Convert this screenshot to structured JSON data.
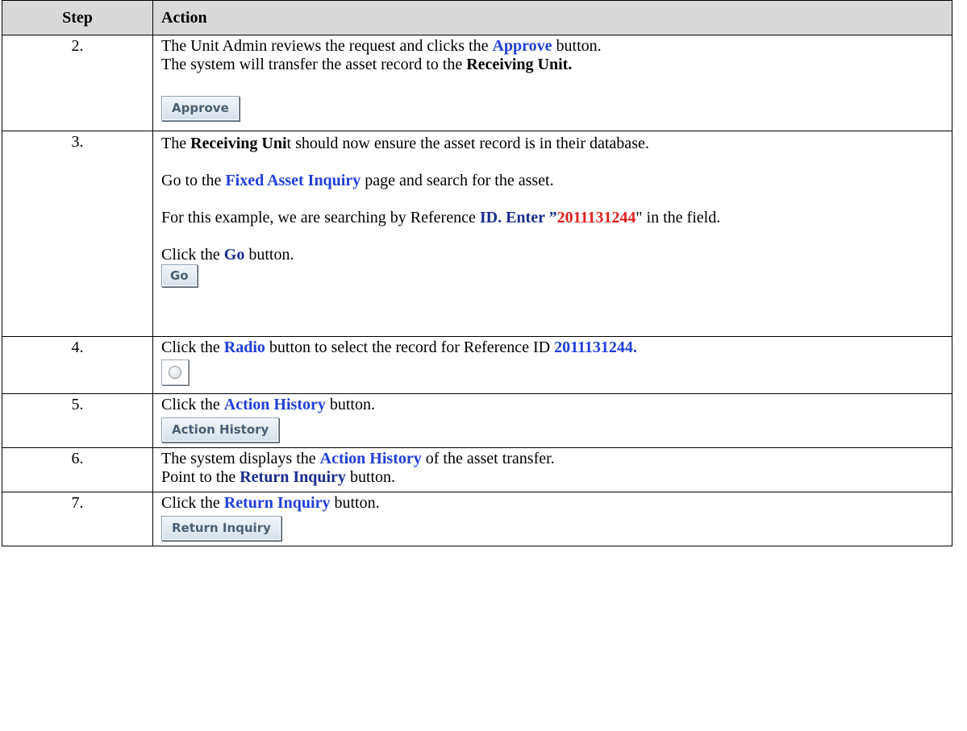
{
  "table": {
    "headers": {
      "step": "Step",
      "action": "Action"
    },
    "rows": [
      {
        "step": "2.",
        "lines": [
          {
            "t1": "The Unit Admin reviews the request and clicks the ",
            "h1": "Approve",
            "t2": " button."
          },
          {
            "t1": "The system will transfer the asset record to the ",
            "h1": "Receiving Unit."
          }
        ],
        "button": "Approve"
      },
      {
        "step": "3.",
        "p1": {
          "t1": "The ",
          "h1": "Receiving Uni",
          "t2": "t should now ensure the asset record is in their database."
        },
        "p2": {
          "t1": "Go to the ",
          "h1": "Fixed Asset Inquiry",
          "t2": " page and search for the asset."
        },
        "p3": {
          "t1": "For this example, we are searching by Reference ",
          "h1": "ID.  Enter ”",
          "h2": "2011131244",
          "t2": "\" in the field."
        },
        "p4": {
          "t1": "Click the ",
          "h1": "Go",
          "t2": " button."
        },
        "button": "Go"
      },
      {
        "step": "4.",
        "line": {
          "t1": "Click the ",
          "h1": "Radio",
          "t2": " button to select the record for Reference ID ",
          "h2": "2011131244."
        },
        "icon": "radio-button-icon"
      },
      {
        "step": "5.",
        "line": {
          "t1": "Click the ",
          "h1": "Action History",
          "t2": " button."
        },
        "button": "Action History"
      },
      {
        "step": "6.",
        "lines": [
          {
            "t1": "The system displays the ",
            "h1": "Action History",
            "t2": " of the asset transfer."
          },
          {
            "t1": "Point to the ",
            "h1": "Return Inquiry",
            "t2": " button."
          }
        ]
      },
      {
        "step": "7.",
        "line": {
          "t1": "Click the ",
          "h1": "Return Inquiry",
          "t2": " button."
        },
        "button": "Return Inquiry"
      }
    ]
  },
  "colors": {
    "link_blue": "#1f3fd8",
    "navy": "#1a2d8c",
    "red": "#e0201f",
    "header_bg": "#d9d9d9"
  }
}
